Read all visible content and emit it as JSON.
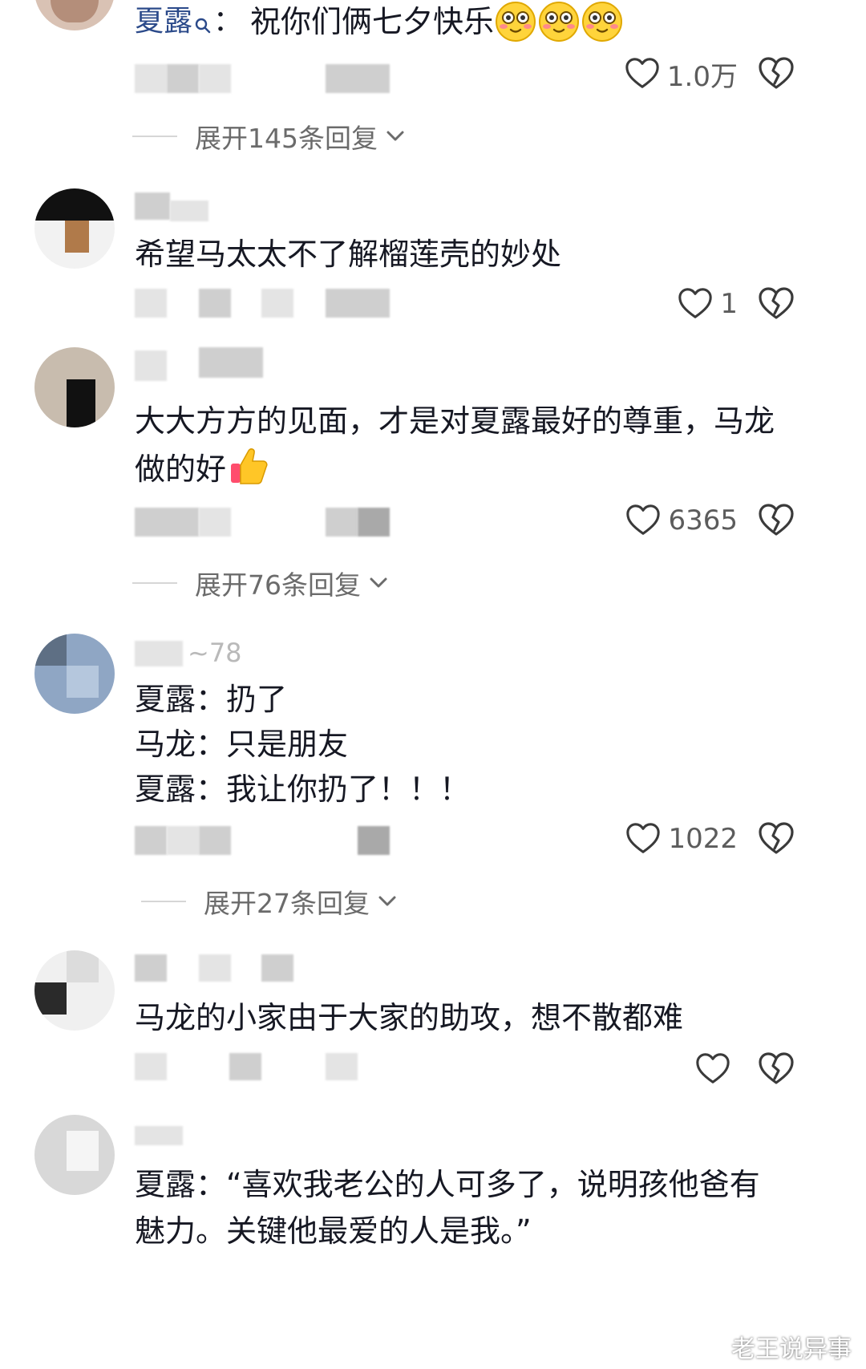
{
  "comments": [
    {
      "username": "夏露",
      "prefix": "：",
      "text": "祝你们俩七夕快乐",
      "likes": "1.0万",
      "expand": "展开145条回复"
    },
    {
      "text": "希望马太太不了解榴莲壳的妙处",
      "likes": "1"
    },
    {
      "text_line1": "大大方方的见面，才是对夏露最好的尊重，马龙",
      "text_line2": "做的好",
      "likes": "6365",
      "expand": "展开76条回复"
    },
    {
      "username_partial": "~78",
      "line1": "夏露：扔了",
      "line2": "马龙：只是朋友",
      "line3": "夏露：我让你扔了！！！",
      "likes": "1022",
      "expand": "展开27条回复"
    },
    {
      "text": "马龙的小家由于大家的助攻，想不散都难",
      "likes": ""
    },
    {
      "line1": "夏露：“喜欢我老公的人可多了，说明孩他爸有",
      "line2": "魅力。关键他最爱的人是我。”"
    }
  ],
  "watermark": "老王说异事",
  "icons": {
    "like": "heart-outline-icon",
    "dislike": "broken-heart-icon",
    "expand": "chevron-down-icon",
    "search": "search-icon",
    "emoji_smile": "blushing-face-emoji",
    "emoji_thumb": "thumbs-up-emoji"
  }
}
